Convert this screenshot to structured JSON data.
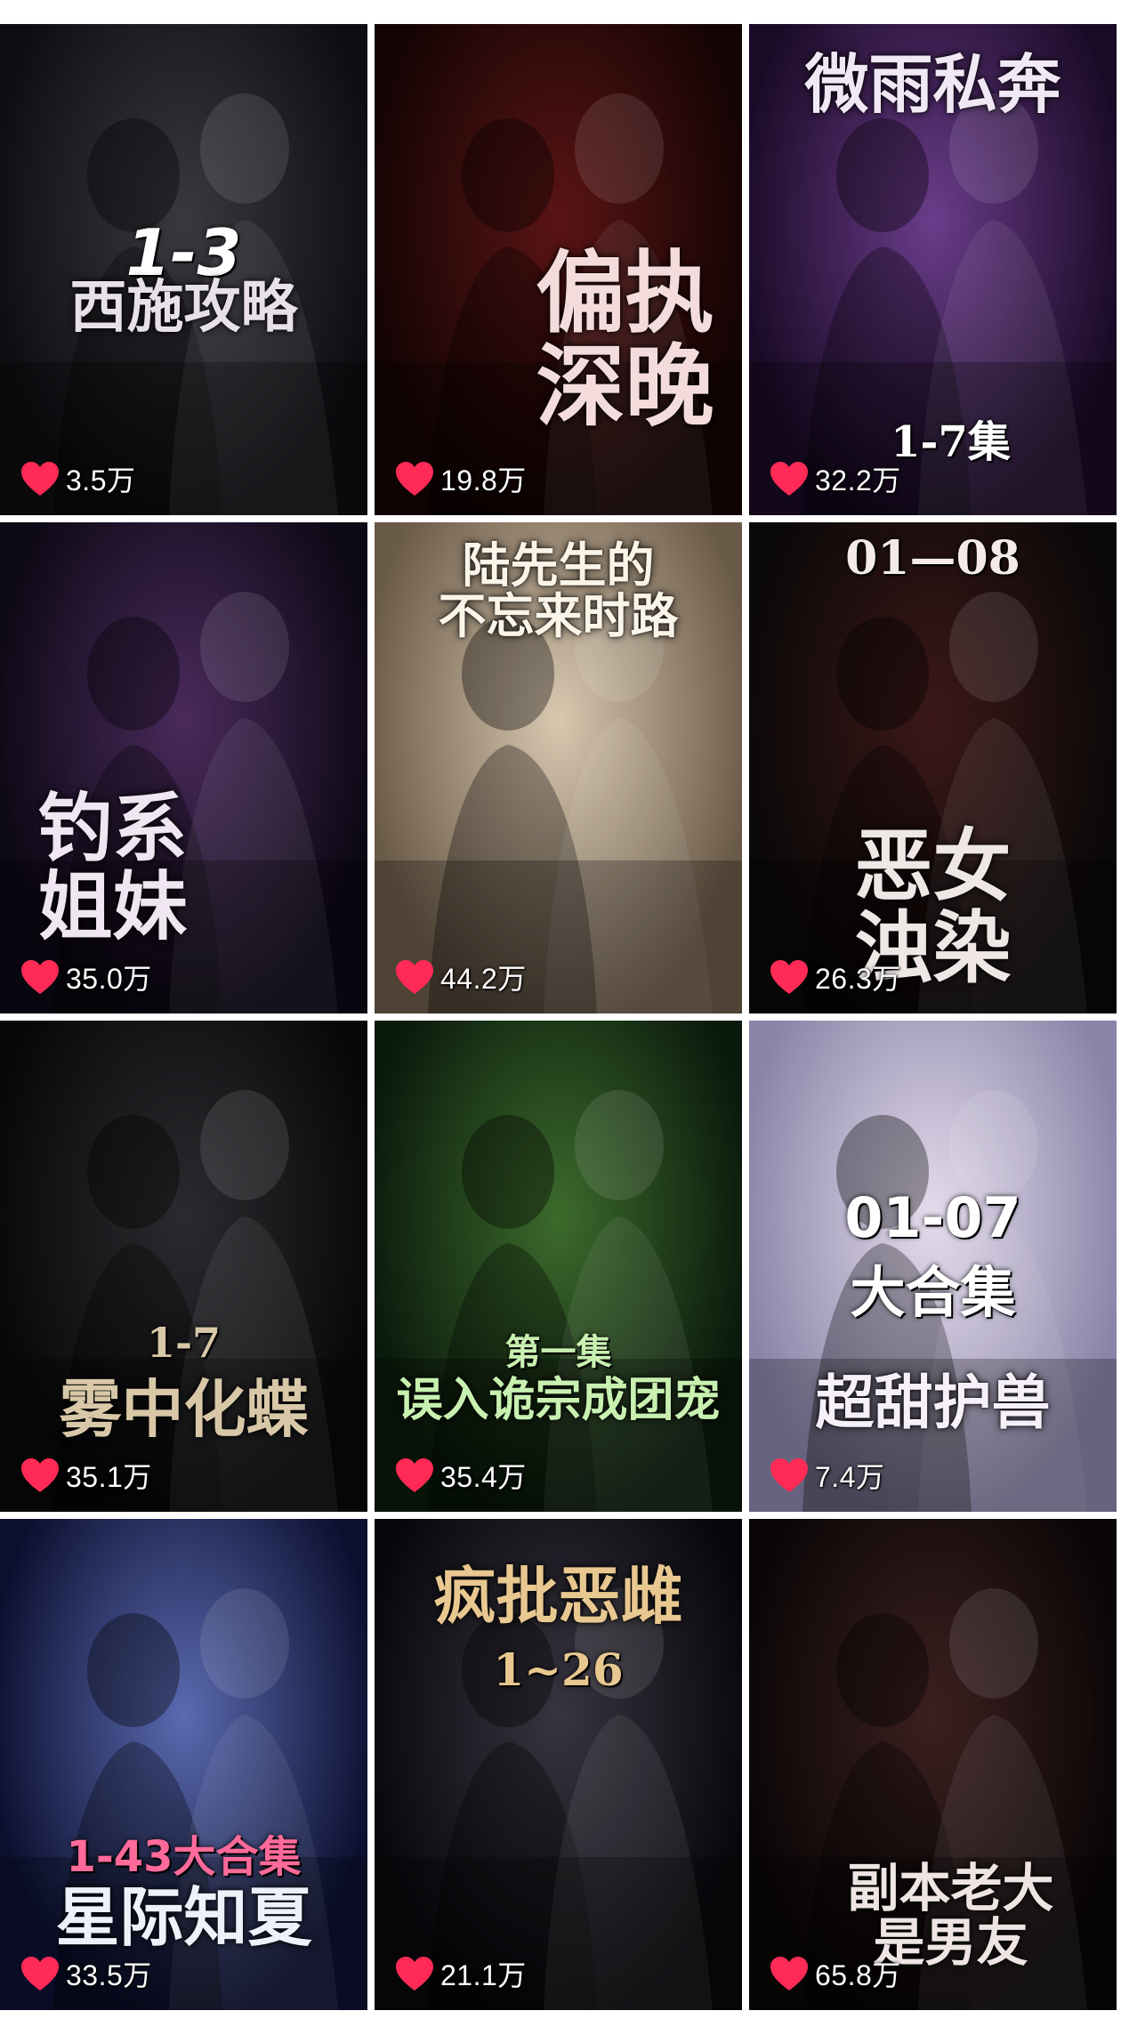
{
  "colors": {
    "heart": "#ff2a55",
    "count_text": "#ffffff",
    "page_bg": "#ffffff"
  },
  "cards": [
    {
      "id": "card-1",
      "title": "西施攻略",
      "badge": "1-3",
      "likes": "3.5万",
      "theme": {
        "bg1": "#0e0e12",
        "bg2": "#3a3840",
        "title": "#e8e0e8",
        "badge": "#ffffff"
      }
    },
    {
      "id": "card-2",
      "title": "偏执\n深晚",
      "badge": "",
      "likes": "19.8万",
      "theme": {
        "bg1": "#140404",
        "bg2": "#5a1414",
        "title": "#f4dcdc",
        "badge": "#ffffff"
      }
    },
    {
      "id": "card-3",
      "title": "微雨私奔",
      "badge": "1-7集",
      "likes": "32.2万",
      "theme": {
        "bg1": "#1a0a26",
        "bg2": "#6a3c8a",
        "title": "#f0e8f4",
        "badge": "#ffffff"
      }
    },
    {
      "id": "card-4",
      "title": "钓系\n姐妹",
      "badge": "",
      "likes": "35.0万",
      "theme": {
        "bg1": "#0c0814",
        "bg2": "#4a2a5c",
        "title": "#f0e6f2",
        "badge": "#ffffff"
      }
    },
    {
      "id": "card-5",
      "title": "陆先生的\n不忘来时路",
      "badge": "",
      "likes": "44.2万",
      "theme": {
        "bg1": "#6a5a48",
        "bg2": "#d8c8b0",
        "title": "#fbf4e8",
        "badge": "#ffffff"
      }
    },
    {
      "id": "card-6",
      "title": "恶女\n浊染",
      "badge": "01—08",
      "likes": "26.3万",
      "theme": {
        "bg1": "#0a0808",
        "bg2": "#3c1818",
        "title": "#efe6e6",
        "badge": "#f4eaea"
      }
    },
    {
      "id": "card-7",
      "title": "雾中化蝶",
      "badge": "1-7",
      "likes": "35.1万",
      "theme": {
        "bg1": "#08080a",
        "bg2": "#2c2a2e",
        "title": "#d8c8a8",
        "badge": "#d8c8a8"
      }
    },
    {
      "id": "card-8",
      "title": "误入诡宗成团宠",
      "badge": "第一集",
      "likes": "35.4万",
      "theme": {
        "bg1": "#0a1a0c",
        "bg2": "#3c6a2c",
        "title": "#c8f0b0",
        "badge": "#c8f0b0"
      }
    },
    {
      "id": "card-9",
      "title": "超甜护兽",
      "badge": "01-07\n大合集",
      "likes": "7.4万",
      "theme": {
        "bg1": "#8a84a8",
        "bg2": "#e4dcec",
        "title": "#f6f0fa",
        "badge": "#ffffff"
      }
    },
    {
      "id": "card-10",
      "title": "星际知夏",
      "badge": "1-43大合集",
      "likes": "33.5万",
      "theme": {
        "bg1": "#0c1030",
        "bg2": "#5a6ab0",
        "title": "#eef0fa",
        "badge": "#ff6a9a"
      }
    },
    {
      "id": "card-11",
      "title": "疯批恶雌",
      "badge": "1~26",
      "likes": "21.1万",
      "theme": {
        "bg1": "#08080c",
        "bg2": "#383440",
        "title": "#e8c890",
        "badge": "#e8c890"
      }
    },
    {
      "id": "card-12",
      "title": "副本老大\n是男友",
      "badge": "",
      "likes": "65.8万",
      "theme": {
        "bg1": "#0a0606",
        "bg2": "#3c2020",
        "title": "#efe4e4",
        "badge": "#ffffff"
      }
    }
  ]
}
